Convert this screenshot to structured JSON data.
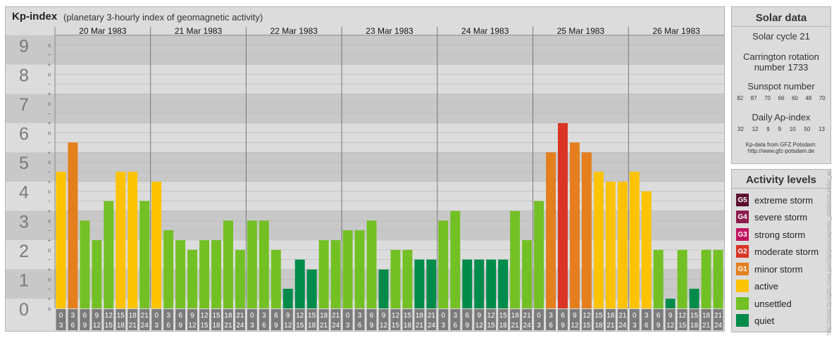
{
  "header": {
    "title": "Kp-index",
    "subtitle": "(planetary 3-hourly index of geomagnetic activity)"
  },
  "chart_data": {
    "type": "bar",
    "title": "Kp-index",
    "subtitle": "(planetary 3-hourly index of geomagnetic activity)",
    "ylim": [
      0,
      9
    ],
    "y_ticks": [
      "0",
      "1",
      "2",
      "3",
      "4",
      "5",
      "6",
      "7",
      "8",
      "9"
    ],
    "minor_ticks": [
      "o",
      "+",
      "−"
    ],
    "days": [
      "20 Mar 1983",
      "21 Mar 1983",
      "22 Mar 1983",
      "23 Mar 1983",
      "24 Mar 1983",
      "25 Mar 1983",
      "26 Mar 1983"
    ],
    "slot_labels": [
      [
        "0",
        "3"
      ],
      [
        "3",
        "6"
      ],
      [
        "6",
        "9"
      ],
      [
        "9",
        "12"
      ],
      [
        "12",
        "15"
      ],
      [
        "15",
        "18"
      ],
      [
        "18",
        "21"
      ],
      [
        "21",
        "24"
      ]
    ],
    "values": [
      [
        4.67,
        5.67,
        3.0,
        2.33,
        3.67,
        4.67,
        4.67,
        3.67
      ],
      [
        4.33,
        2.67,
        2.33,
        2.0,
        2.33,
        2.33,
        3.0,
        2.0
      ],
      [
        3.0,
        3.0,
        2.0,
        0.67,
        1.67,
        1.33,
        2.33,
        2.33
      ],
      [
        2.67,
        2.67,
        3.0,
        1.33,
        2.0,
        2.0,
        1.67,
        1.67
      ],
      [
        3.0,
        3.33,
        1.67,
        1.67,
        1.67,
        1.67,
        3.33,
        2.33
      ],
      [
        3.67,
        5.33,
        6.33,
        5.67,
        5.33,
        4.67,
        4.33,
        4.33
      ],
      [
        4.67,
        4.0,
        2.0,
        0.33,
        2.0,
        0.67,
        2.0,
        2.0
      ]
    ],
    "color_scale": [
      {
        "min": 0,
        "max": 2,
        "color": "#008b4a"
      },
      {
        "min": 2,
        "max": 4,
        "color": "#73c024"
      },
      {
        "min": 4,
        "max": 5,
        "color": "#fdc300"
      },
      {
        "min": 5,
        "max": 6,
        "color": "#e57f1e"
      },
      {
        "min": 6,
        "max": 9,
        "color": "#d93424"
      }
    ],
    "grid": true,
    "legend_position": "right"
  },
  "solar": {
    "title": "Solar data",
    "cycle": "Solar cycle 21",
    "carrington_line1": "Carrington rotation",
    "carrington_line2": "number 1733",
    "sunspot_title": "Sunspot number",
    "sunspots": [
      "82",
      "87",
      "70",
      "66",
      "60",
      "48",
      "70"
    ],
    "ap_title": "Daily Ap-index",
    "ap": [
      "32",
      "12",
      "9",
      "9",
      "10",
      "50",
      "13"
    ],
    "source_line1": "Kp-data from GFZ Potsdam:",
    "source_line2": "http://www.gfz-potsdam.de"
  },
  "levels": {
    "title": "Activity levels",
    "items": [
      {
        "code": "G5",
        "label": "extreme storm",
        "color": "#5a0f2e"
      },
      {
        "code": "G4",
        "label": "severe storm",
        "color": "#8e1a4e"
      },
      {
        "code": "G3",
        "label": "strong storm",
        "color": "#c4135e"
      },
      {
        "code": "G2",
        "label": "moderate storm",
        "color": "#d93424"
      },
      {
        "code": "G1",
        "label": "minor storm",
        "color": "#e57f1e"
      },
      {
        "code": "",
        "label": "active",
        "color": "#fdc300"
      },
      {
        "code": "",
        "label": "unsettled",
        "color": "#73c024"
      },
      {
        "code": "",
        "label": "quiet",
        "color": "#008b4a"
      }
    ]
  },
  "watermark": "http://www.ftp.ngdc.noaa.gov/stp/geomagnetic_data/indices/kp_ap"
}
